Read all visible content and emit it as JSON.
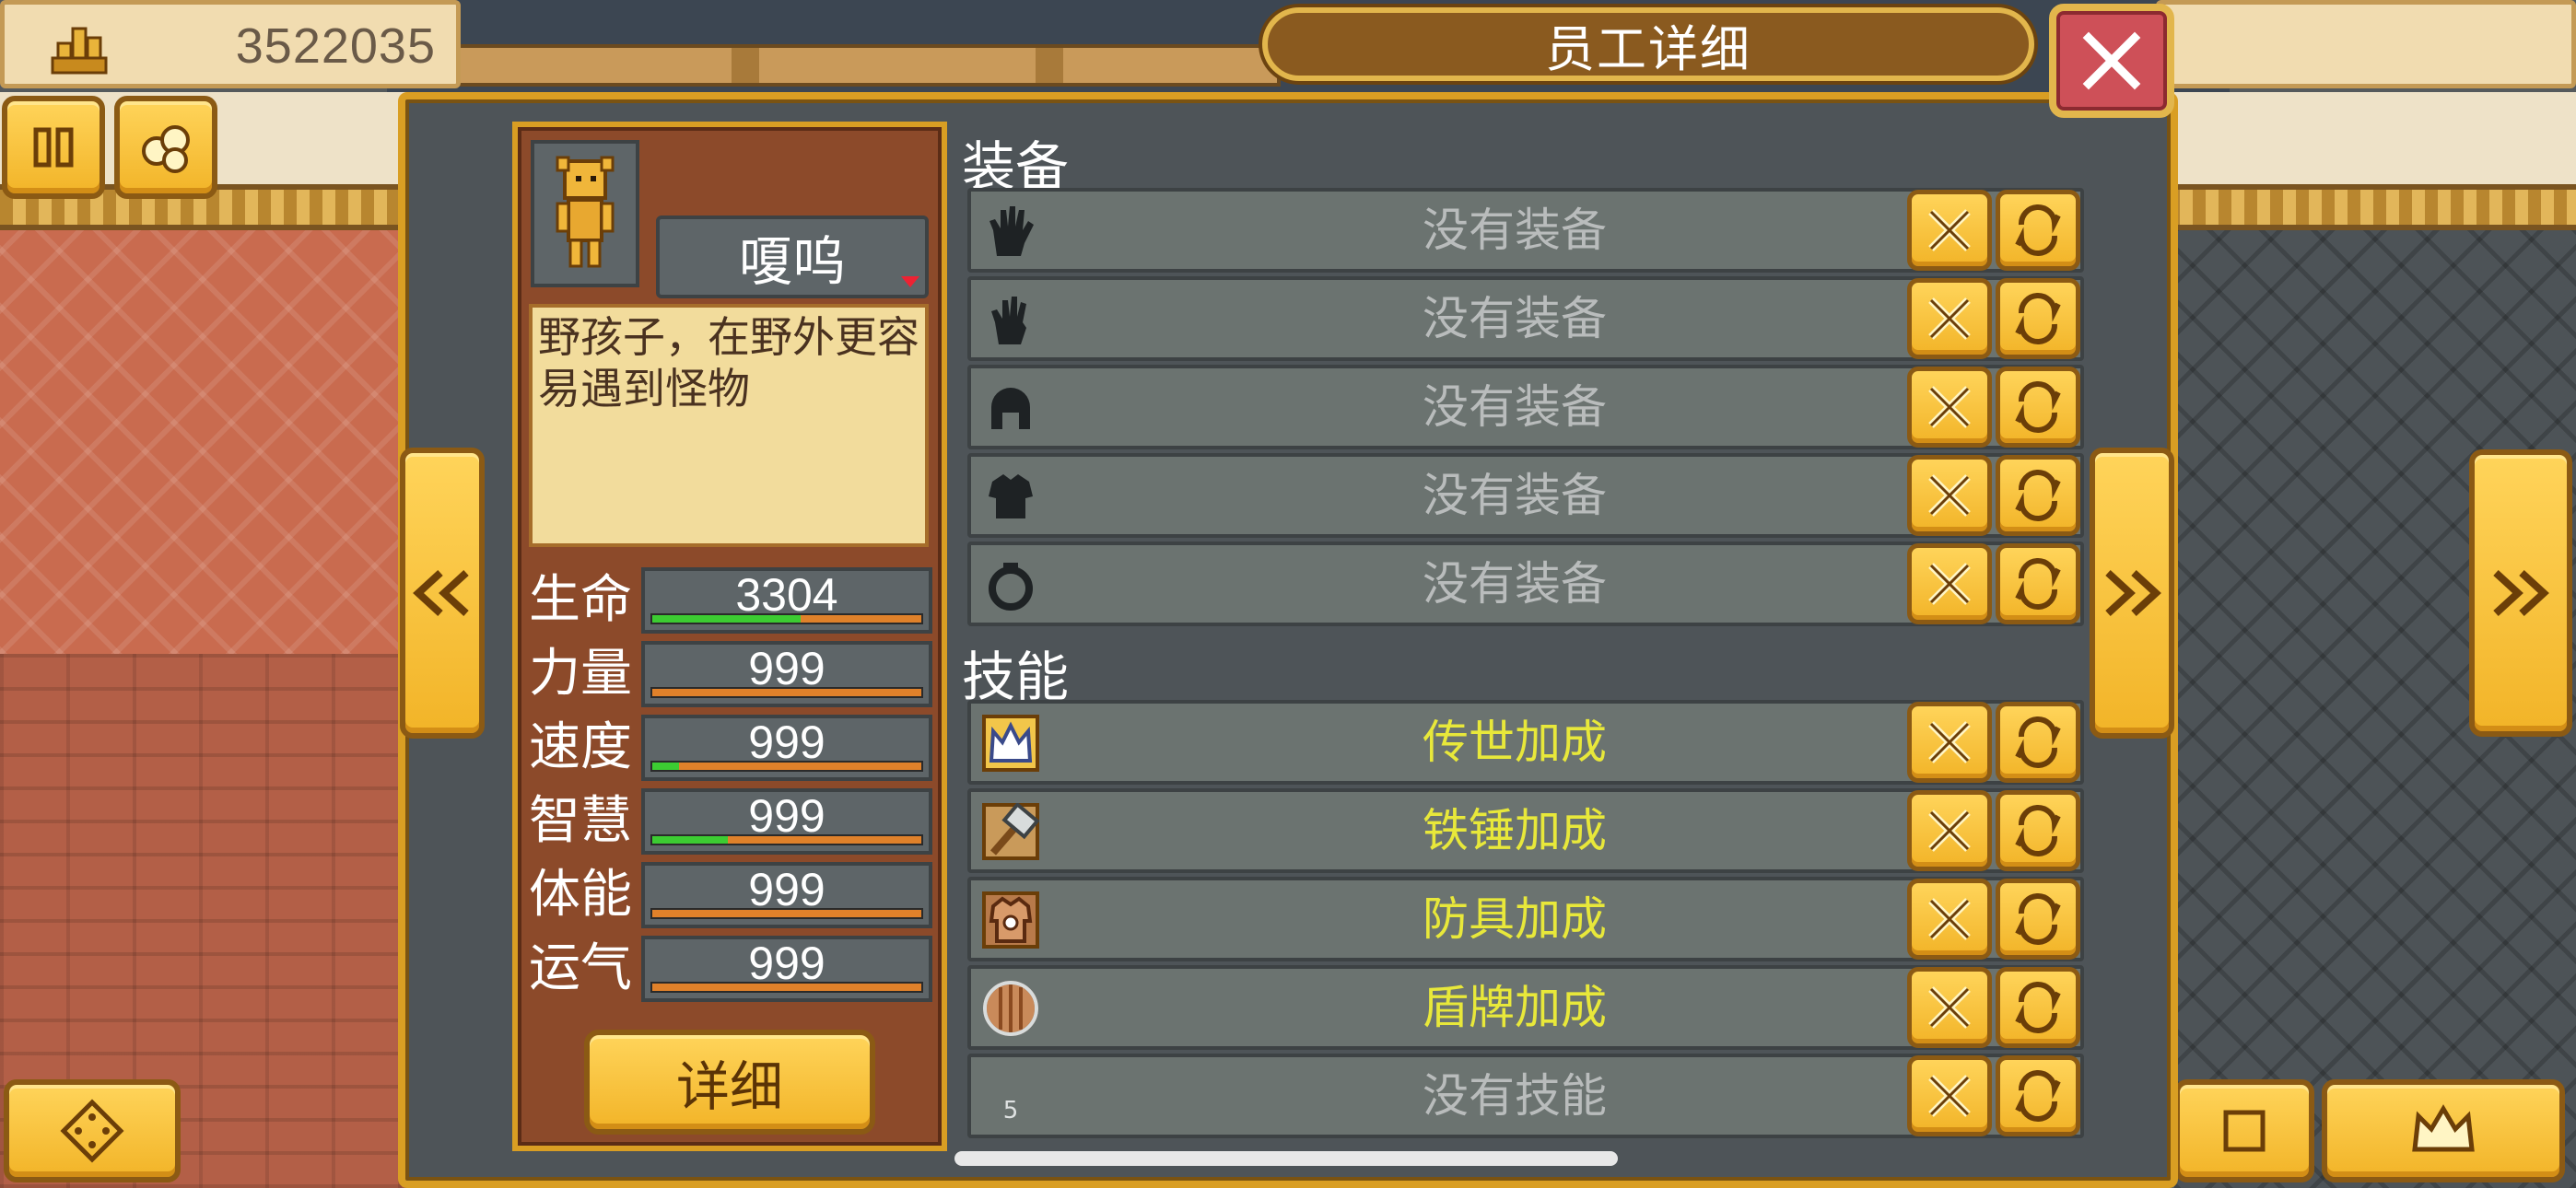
{
  "hud": {
    "gold": "3522035"
  },
  "dialog": {
    "title": "员工详细",
    "character": {
      "name": "嗄呜",
      "description": "野孩子，在野外更容易遇到怪物",
      "stats": [
        {
          "label": "生命",
          "value": "3304",
          "fill": 0.55
        },
        {
          "label": "力量",
          "value": "999",
          "fill": 0.0
        },
        {
          "label": "速度",
          "value": "999",
          "fill": 0.1
        },
        {
          "label": "智慧",
          "value": "999",
          "fill": 0.28
        },
        {
          "label": "体能",
          "value": "999",
          "fill": 0.0
        },
        {
          "label": "运气",
          "value": "999",
          "fill": 0.0
        }
      ],
      "detail_button": "详细"
    },
    "equipment": {
      "title": "装备",
      "items": [
        {
          "icon": "glove-icon",
          "text": "没有装备"
        },
        {
          "icon": "gauntlet-icon",
          "text": "没有装备"
        },
        {
          "icon": "helmet-icon",
          "text": "没有装备"
        },
        {
          "icon": "armor-icon",
          "text": "没有装备"
        },
        {
          "icon": "ring-icon",
          "text": "没有装备"
        }
      ]
    },
    "skills": {
      "title": "技能",
      "items": [
        {
          "icon": "crown-skill-icon",
          "text": "传世加成"
        },
        {
          "icon": "hammer-skill-icon",
          "text": "铁锤加成"
        },
        {
          "icon": "armor-skill-icon",
          "text": "防具加成"
        },
        {
          "icon": "shield-skill-icon",
          "text": "盾牌加成"
        },
        {
          "icon": "empty-slot-icon",
          "text": "没有技能",
          "slot": "5"
        }
      ]
    }
  },
  "colors": {
    "gold_button": "#f2b428",
    "panel_bg": "#4e5458",
    "skill_text": "#e8e83a",
    "empty_text": "#b9bcbc",
    "close_red": "#ce5058",
    "bar_green": "#3ccc32",
    "bar_orange": "#e0812a"
  }
}
